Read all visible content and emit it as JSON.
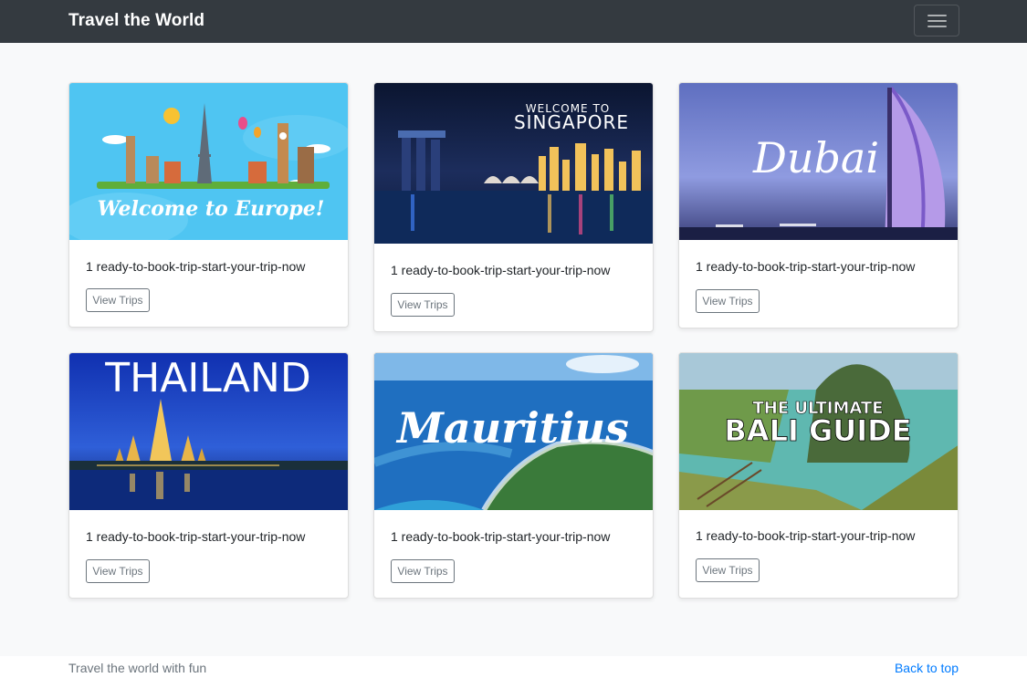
{
  "navbar": {
    "brand": "Travel the World",
    "toggler_icon": "hamburger-menu-icon"
  },
  "cards": [
    {
      "image_caption": "Welcome to Europe!",
      "text": "1 ready-to-book-trip-start-your-trip-now",
      "button": "View Trips"
    },
    {
      "image_caption": "WELCOME TO SINGAPORE",
      "text": "1 ready-to-book-trip-start-your-trip-now",
      "button": "View Trips"
    },
    {
      "image_caption": "Dubai",
      "text": "1 ready-to-book-trip-start-your-trip-now",
      "button": "View Trips"
    },
    {
      "image_caption": "THAILAND",
      "text": "1 ready-to-book-trip-start-your-trip-now",
      "button": "View Trips"
    },
    {
      "image_caption": "Mauritius",
      "text": "1 ready-to-book-trip-start-your-trip-now",
      "button": "View Trips"
    },
    {
      "image_caption": "THE ULTIMATE BALI GUIDE",
      "text": "1 ready-to-book-trip-start-your-trip-now",
      "button": "View Trips"
    }
  ],
  "footer": {
    "text": "Travel the world with fun",
    "back_to_top": "Back to top"
  },
  "colors": {
    "navbar": "#343a40",
    "link": "#007bff",
    "button_outline": "#6c757d"
  }
}
